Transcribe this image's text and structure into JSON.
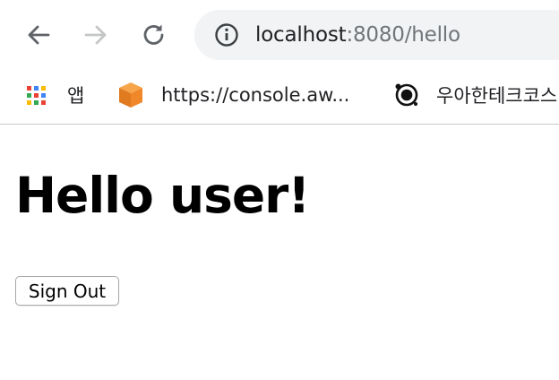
{
  "address_bar": {
    "host": "localhost",
    "rest": ":8080/hello"
  },
  "bookmarks": [
    {
      "label": "앱",
      "icon": "apps-grid-icon"
    },
    {
      "label": "https://console.aw...",
      "icon": "aws-cube-icon"
    },
    {
      "label": "우아한테크코스",
      "icon": "target-circle-icon"
    }
  ],
  "page": {
    "heading": "Hello user!",
    "sign_out_label": "Sign Out"
  },
  "colors": {
    "omnibox_bg": "#f1f3f4",
    "url_host": "#202124",
    "url_rest": "#70757a",
    "aws_orange": "#f0882a"
  }
}
